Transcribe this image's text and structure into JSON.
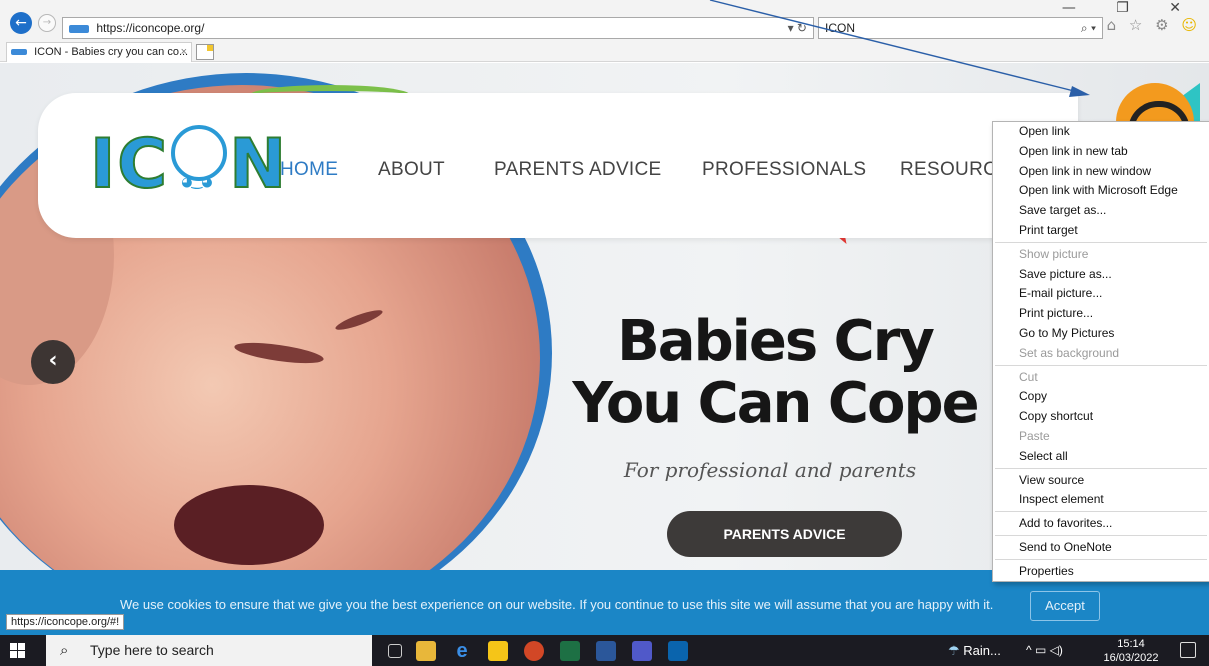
{
  "browser": {
    "url": "https://iconcope.org/",
    "search_text": "ICON",
    "tab_title": "ICON - Babies cry you can co...",
    "tab_close": "×",
    "refresh_glyph": "▾ ↻",
    "search_glyph": "⌕ ▾",
    "window_controls": "— ❐ ✕",
    "tool_icons": [
      "⌂",
      "☆",
      "⚙",
      "☺"
    ]
  },
  "site": {
    "logo_left": "IC",
    "logo_right": "N",
    "nav": [
      {
        "label": "HOME",
        "active": true
      },
      {
        "label": "ABOUT",
        "active": false
      },
      {
        "label": "PARENTS ADVICE",
        "active": false
      },
      {
        "label": "PROFESSIONALS",
        "active": false
      },
      {
        "label": "RESOURCES",
        "active": false
      }
    ],
    "headline_line1": "Babies Cry",
    "headline_line2": "You Can Cope",
    "subheadline": "For professional and parents",
    "cta_label": "PARENTS ADVICE",
    "prev_arrow": "‹",
    "cookie_text": "We use cookies to ensure that we give you the best experience on our website. If you continue to use this site we will assume that you are happy with it.",
    "accept_label": "Accept",
    "status_url": "https://iconcope.org/#!"
  },
  "context_menu": [
    {
      "label": "Open link",
      "enabled": true
    },
    {
      "label": "Open link in new tab",
      "enabled": true
    },
    {
      "label": "Open link in new window",
      "enabled": true
    },
    {
      "label": "Open link with Microsoft Edge",
      "enabled": true
    },
    {
      "label": "Save target as...",
      "enabled": true
    },
    {
      "label": "Print target",
      "enabled": true
    },
    {
      "separator": true
    },
    {
      "label": "Show picture",
      "enabled": false
    },
    {
      "label": "Save picture as...",
      "enabled": true
    },
    {
      "label": "E-mail picture...",
      "enabled": true
    },
    {
      "label": "Print picture...",
      "enabled": true
    },
    {
      "label": "Go to My Pictures",
      "enabled": true
    },
    {
      "label": "Set as background",
      "enabled": false
    },
    {
      "separator": true
    },
    {
      "label": "Cut",
      "enabled": false
    },
    {
      "label": "Copy",
      "enabled": true
    },
    {
      "label": "Copy shortcut",
      "enabled": true
    },
    {
      "label": "Paste",
      "enabled": false
    },
    {
      "label": "Select all",
      "enabled": true
    },
    {
      "separator": true
    },
    {
      "label": "View source",
      "enabled": true
    },
    {
      "label": "Inspect element",
      "enabled": true
    },
    {
      "separator": true
    },
    {
      "label": "Add to favorites...",
      "enabled": true
    },
    {
      "separator": true
    },
    {
      "label": "Send to OneNote",
      "enabled": true
    },
    {
      "separator": true
    },
    {
      "label": "Properties",
      "enabled": true
    }
  ],
  "taskbar": {
    "search_placeholder": "Type here to search",
    "weather": "Rain...",
    "time": "15:14",
    "date": "16/03/2022",
    "tray_icons": "^ ▭ ◁)"
  },
  "colors": {
    "brand_blue": "#2e7bc4",
    "cookie_bar": "#1b86c6",
    "cta_dark": "#3d3a39",
    "avatar_orange": "#f39a1e",
    "annotation_arrow": "#2b5fa8"
  }
}
